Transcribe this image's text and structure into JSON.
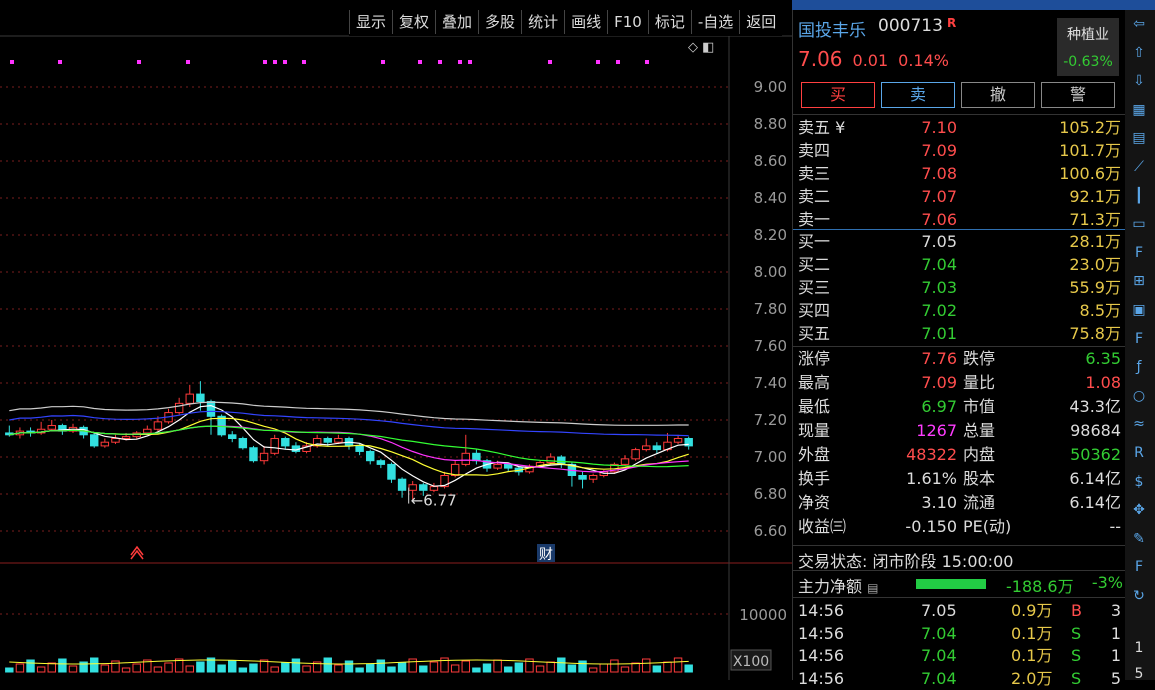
{
  "toolbar": [
    "显示",
    "复权",
    "叠加",
    "多股",
    "统计",
    "画线",
    "F10",
    "标记",
    "-自选",
    "返回"
  ],
  "chart_data": {
    "type": "candlestick",
    "y_ticks": [
      "9.00",
      "8.80",
      "8.60",
      "8.40",
      "8.20",
      "8.00",
      "7.80",
      "7.60",
      "7.40",
      "7.20",
      "7.00",
      "6.80",
      "6.60"
    ],
    "ylim": [
      6.6,
      9.0
    ],
    "low_annotation": "6.77",
    "event_marker": "财",
    "volume_tick": "10000",
    "volume_scale": "X100",
    "colors": {
      "up": "#ff3b3b",
      "down": "#33e0e0",
      "ma5": "#ffffff",
      "ma10": "#ffff33",
      "ma20": "#ff33ff",
      "ma30": "#33ff33",
      "ma60": "#3344ff",
      "ma120": "#cccccc"
    },
    "candles": [
      [
        7.13,
        7.12,
        7.17,
        7.11
      ],
      [
        7.12,
        7.14,
        7.16,
        7.1
      ],
      [
        7.14,
        7.13,
        7.16,
        7.11
      ],
      [
        7.13,
        7.15,
        7.19,
        7.12
      ],
      [
        7.15,
        7.17,
        7.2,
        7.14
      ],
      [
        7.17,
        7.14,
        7.18,
        7.12
      ],
      [
        7.14,
        7.16,
        7.18,
        7.13
      ],
      [
        7.16,
        7.12,
        7.17,
        7.1
      ],
      [
        7.12,
        7.06,
        7.13,
        7.05
      ],
      [
        7.06,
        7.08,
        7.1,
        7.05
      ],
      [
        7.08,
        7.1,
        7.12,
        7.07
      ],
      [
        7.1,
        7.11,
        7.13,
        7.09
      ],
      [
        7.11,
        7.13,
        7.14,
        7.1
      ],
      [
        7.13,
        7.15,
        7.17,
        7.12
      ],
      [
        7.15,
        7.19,
        7.22,
        7.14
      ],
      [
        7.19,
        7.24,
        7.26,
        7.18
      ],
      [
        7.24,
        7.29,
        7.32,
        7.23
      ],
      [
        7.29,
        7.34,
        7.39,
        7.27
      ],
      [
        7.34,
        7.3,
        7.41,
        7.25
      ],
      [
        7.3,
        7.22,
        7.31,
        7.12
      ],
      [
        7.22,
        7.12,
        7.23,
        7.11
      ],
      [
        7.12,
        7.1,
        7.14,
        7.08
      ],
      [
        7.1,
        7.05,
        7.11,
        7.04
      ],
      [
        7.05,
        6.98,
        7.06,
        6.97
      ],
      [
        6.98,
        7.02,
        7.06,
        6.96
      ],
      [
        7.02,
        7.1,
        7.12,
        7.01
      ],
      [
        7.1,
        7.06,
        7.11,
        7.04
      ],
      [
        7.06,
        7.03,
        7.08,
        7.02
      ],
      [
        7.03,
        7.06,
        7.08,
        7.02
      ],
      [
        7.06,
        7.1,
        7.12,
        7.05
      ],
      [
        7.1,
        7.08,
        7.11,
        7.06
      ],
      [
        7.08,
        7.1,
        7.12,
        7.07
      ],
      [
        7.1,
        7.06,
        7.11,
        7.04
      ],
      [
        7.06,
        7.03,
        7.07,
        7.01
      ],
      [
        7.03,
        6.98,
        7.04,
        6.96
      ],
      [
        6.98,
        6.96,
        6.99,
        6.94
      ],
      [
        6.96,
        6.88,
        6.97,
        6.86
      ],
      [
        6.88,
        6.82,
        6.89,
        6.78
      ],
      [
        6.82,
        6.85,
        6.87,
        6.77
      ],
      [
        6.85,
        6.82,
        6.86,
        6.79
      ],
      [
        6.82,
        6.84,
        6.86,
        6.81
      ],
      [
        6.84,
        6.9,
        6.92,
        6.83
      ],
      [
        6.9,
        6.96,
        6.98,
        6.89
      ],
      [
        6.96,
        7.02,
        7.12,
        6.95
      ],
      [
        7.02,
        6.98,
        7.04,
        6.96
      ],
      [
        6.98,
        6.94,
        6.99,
        6.92
      ],
      [
        6.94,
        6.96,
        6.98,
        6.93
      ],
      [
        6.96,
        6.94,
        6.97,
        6.92
      ],
      [
        6.94,
        6.92,
        6.95,
        6.9
      ],
      [
        6.92,
        6.95,
        6.96,
        6.91
      ],
      [
        6.95,
        6.97,
        6.98,
        6.94
      ],
      [
        6.97,
        7.0,
        7.02,
        6.96
      ],
      [
        7.0,
        6.96,
        7.01,
        6.94
      ],
      [
        6.96,
        6.9,
        6.97,
        6.84
      ],
      [
        6.9,
        6.88,
        6.92,
        6.83
      ],
      [
        6.88,
        6.9,
        6.91,
        6.86
      ],
      [
        6.9,
        6.92,
        6.93,
        6.89
      ],
      [
        6.92,
        6.96,
        6.97,
        6.91
      ],
      [
        6.96,
        6.99,
        7.01,
        6.95
      ],
      [
        6.99,
        7.04,
        7.05,
        6.98
      ],
      [
        7.04,
        7.06,
        7.1,
        7.03
      ],
      [
        7.06,
        7.04,
        7.08,
        7.02
      ],
      [
        7.04,
        7.08,
        7.13,
        7.03
      ],
      [
        7.08,
        7.1,
        7.12,
        7.07
      ],
      [
        7.1,
        7.06,
        7.11,
        7.04
      ]
    ]
  },
  "quote": {
    "name": "国投丰乐",
    "code": "000713",
    "flag": "R",
    "price": "7.06",
    "change": "0.01",
    "pct": "0.14%",
    "sector_name": "种植业",
    "sector_pct": "-0.63%",
    "actions": [
      "买",
      "卖",
      "撤",
      "警"
    ],
    "asks": [
      {
        "label": "卖五 ¥",
        "price": "7.10",
        "vol": "105.2万"
      },
      {
        "label": "卖四",
        "price": "7.09",
        "vol": "101.7万"
      },
      {
        "label": "卖三",
        "price": "7.08",
        "vol": "100.6万"
      },
      {
        "label": "卖二",
        "price": "7.07",
        "vol": "92.1万"
      },
      {
        "label": "卖一",
        "price": "7.06",
        "vol": "71.3万"
      }
    ],
    "bids": [
      {
        "label": "买一",
        "price": "7.05",
        "vol": "28.1万"
      },
      {
        "label": "买二",
        "price": "7.04",
        "vol": "23.0万"
      },
      {
        "label": "买三",
        "price": "7.03",
        "vol": "55.9万"
      },
      {
        "label": "买四",
        "price": "7.02",
        "vol": "8.5万"
      },
      {
        "label": "买五",
        "price": "7.01",
        "vol": "75.8万"
      }
    ],
    "stats": [
      {
        "l1": "涨停",
        "v1": "7.76",
        "c1": "red",
        "l2": "跌停",
        "v2": "6.35",
        "c2": "green"
      },
      {
        "l1": "最高",
        "v1": "7.09",
        "c1": "red",
        "l2": "量比",
        "v2": "1.08",
        "c2": "red"
      },
      {
        "l1": "最低",
        "v1": "6.97",
        "c1": "green",
        "l2": "市值",
        "v2": "43.3亿",
        "c2": "white"
      },
      {
        "l1": "现量",
        "v1": "1267",
        "c1": "mag",
        "l2": "总量",
        "v2": "98684",
        "c2": "white"
      },
      {
        "l1": "外盘",
        "v1": "48322",
        "c1": "red",
        "l2": "内盘",
        "v2": "50362",
        "c2": "green"
      },
      {
        "l1": "换手",
        "v1": "1.61%",
        "c1": "white",
        "l2": "股本",
        "v2": "6.14亿",
        "c2": "white"
      },
      {
        "l1": "净资",
        "v1": "3.10",
        "c1": "white",
        "l2": "流通",
        "v2": "6.14亿",
        "c2": "white"
      },
      {
        "l1": "收益㈢",
        "v1": "-0.150",
        "c1": "white",
        "l2": "PE(动)",
        "v2": "--",
        "c2": "white"
      }
    ],
    "status": "交易状态: 闭市阶段 15:00:00",
    "fund_label": "主力净额",
    "fund_value": "-188.6万",
    "fund_pct": "-3%",
    "ticks": [
      {
        "time": "14:56",
        "price": "7.05",
        "vol": "0.9万",
        "bs": "B",
        "n": "3",
        "pc": "white",
        "bc": "red"
      },
      {
        "time": "14:56",
        "price": "7.04",
        "vol": "0.1万",
        "bs": "S",
        "n": "1",
        "pc": "green",
        "bc": "green"
      },
      {
        "time": "14:56",
        "price": "7.04",
        "vol": "0.1万",
        "bs": "S",
        "n": "1",
        "pc": "green",
        "bc": "green"
      },
      {
        "time": "14:56",
        "price": "7.04",
        "vol": "2.0万",
        "bs": "S",
        "n": "5",
        "pc": "green",
        "bc": "green"
      }
    ]
  },
  "side_icons": [
    "arrow-left-icon",
    "arrow-up-icon",
    "arrow-down-icon",
    "grid-icon",
    "table-icon",
    "line-chart-icon",
    "candle-icon",
    "window-icon",
    "f10-icon",
    "tree-icon",
    "calendar-icon",
    "f12-icon",
    "fx-icon",
    "circle-icon",
    "wave-icon",
    "rsi-icon",
    "dollar-icon",
    "move-icon",
    "pencil-icon",
    "f5-icon",
    "refresh-icon"
  ],
  "side_numbers": [
    "1",
    "5"
  ]
}
